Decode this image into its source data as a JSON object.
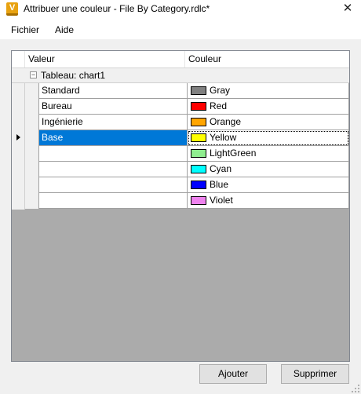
{
  "window": {
    "title": "Attribuer une couleur - File By Category.rdlc*",
    "app_icon_letter": "V",
    "close_glyph": "✕"
  },
  "menu": {
    "items": [
      {
        "label": "Fichier"
      },
      {
        "label": "Aide"
      }
    ]
  },
  "grid": {
    "columns": [
      "Valeur",
      "Couleur"
    ],
    "group": {
      "toggle_glyph": "−",
      "label": "Tableau: chart1"
    },
    "rows": [
      {
        "value": "Standard",
        "color_name": "Gray",
        "color_hex": "#808080"
      },
      {
        "value": "Bureau",
        "color_name": "Red",
        "color_hex": "#ff0000"
      },
      {
        "value": "Ingénierie",
        "color_name": "Orange",
        "color_hex": "#ffa500"
      },
      {
        "value": "Base",
        "color_name": "Yellow",
        "color_hex": "#ffff00",
        "selected": true
      },
      {
        "value": "",
        "color_name": "LightGreen",
        "color_hex": "#90ee90"
      },
      {
        "value": "",
        "color_name": "Cyan",
        "color_hex": "#00ffff"
      },
      {
        "value": "",
        "color_name": "Blue",
        "color_hex": "#0000ff"
      },
      {
        "value": "",
        "color_name": "Violet",
        "color_hex": "#ee82ee"
      }
    ],
    "selected_row_indicator_icon": "current-row-arrow-icon"
  },
  "buttons": {
    "add_label": "Ajouter",
    "delete_label": "Supprimer"
  },
  "colors": {
    "selection": "#0078d7",
    "window_bg": "#f0f0f0",
    "grid_bg": "#ababab"
  }
}
